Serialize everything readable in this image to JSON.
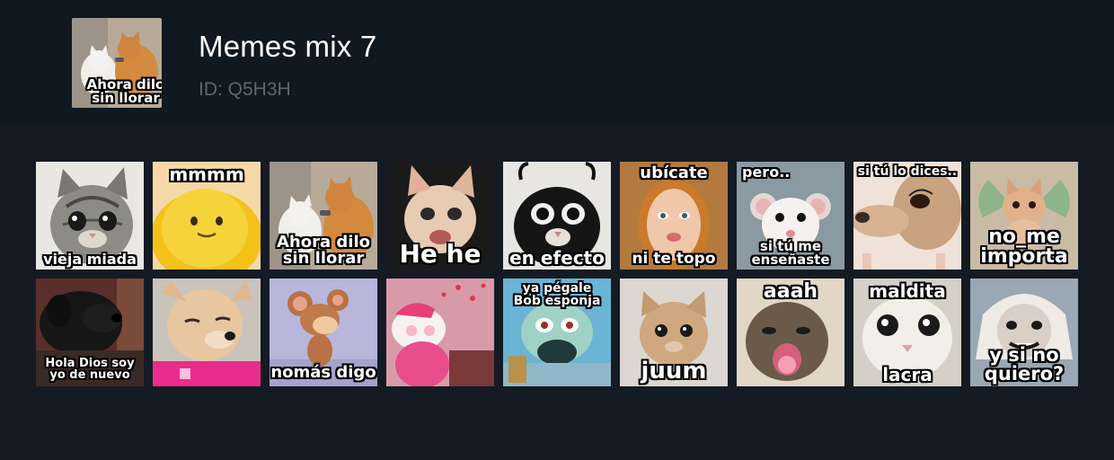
{
  "pack": {
    "title": "Memes mix 7",
    "id_label": "ID: Q5H3H",
    "thumbnail_caption": "Ahora dilo\nsin llorar"
  },
  "stickers": [
    {
      "top": "",
      "bottom": "vieja miada"
    },
    {
      "top": "mmmm",
      "bottom": ""
    },
    {
      "top": "",
      "bottom": "Ahora dilo\nsin llorar"
    },
    {
      "top": "",
      "bottom": "He he"
    },
    {
      "top": "",
      "bottom": "en efecto"
    },
    {
      "top": "ubícate",
      "bottom": "ni te topo"
    },
    {
      "top": "pero..",
      "bottom": "si tú me\nenseñaste"
    },
    {
      "top": "si tú lo dices..",
      "bottom": ""
    },
    {
      "top": "",
      "bottom": "no_me\nimporta"
    },
    {
      "top": "",
      "bottom": "Hola Dios soy\nyo de nuevo"
    },
    {
      "top": "",
      "bottom": ""
    },
    {
      "top": "",
      "bottom": "nomás digo"
    },
    {
      "top": "",
      "bottom": ""
    },
    {
      "top": "ya pégale\nBob esponja",
      "bottom": ""
    },
    {
      "top": "",
      "bottom": "juum"
    },
    {
      "top": "aaah",
      "bottom": ""
    },
    {
      "top": "maldita",
      "bottom": "lacra"
    },
    {
      "top": "",
      "bottom": "y si no\nquiero?"
    }
  ]
}
